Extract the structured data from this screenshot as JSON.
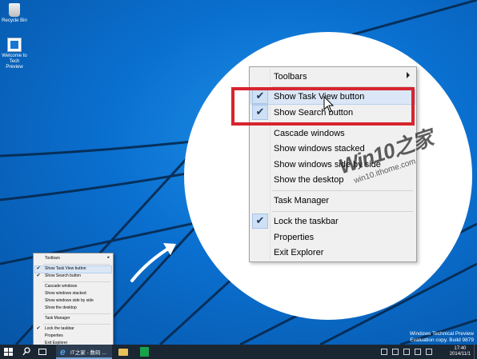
{
  "desktop": {
    "icons": [
      {
        "label": "Recycle Bin"
      },
      {
        "label": "Welcome to Tech Preview"
      }
    ],
    "evaluation": {
      "line1": "Windows Technical Preview",
      "line2": "Evaluation copy. Build 9879"
    }
  },
  "small_menu": {
    "items": [
      {
        "label": "Toolbars",
        "checked": false,
        "submenu": true
      },
      {
        "label": "Show Task View button",
        "checked": true
      },
      {
        "label": "Show Search button",
        "checked": true
      },
      {
        "label": "Cascade windows",
        "checked": false
      },
      {
        "label": "Show windows stacked",
        "checked": false
      },
      {
        "label": "Show windows side by side",
        "checked": false
      },
      {
        "label": "Show the desktop",
        "checked": false
      },
      {
        "label": "Task Manager",
        "checked": false
      },
      {
        "label": "Lock the taskbar",
        "checked": true
      },
      {
        "label": "Properties",
        "checked": false
      },
      {
        "label": "Exit Explorer",
        "checked": false
      }
    ]
  },
  "big_menu": {
    "items": [
      {
        "label": "Toolbars",
        "checked": false,
        "submenu": true
      },
      {
        "label": "Show Task View button",
        "checked": true
      },
      {
        "label": "Show Search button",
        "checked": true
      },
      {
        "label": "Cascade windows",
        "checked": false
      },
      {
        "label": "Show windows stacked",
        "checked": false
      },
      {
        "label": "Show windows side by side",
        "checked": false
      },
      {
        "label": "Show the desktop",
        "checked": false
      },
      {
        "label": "Task Manager",
        "checked": false
      },
      {
        "label": "Lock the taskbar",
        "checked": true
      },
      {
        "label": "Properties",
        "checked": false
      },
      {
        "label": "Exit Explorer",
        "checked": false
      }
    ]
  },
  "watermark": {
    "brand": "Win10之家",
    "url": "win10.ithome.com"
  },
  "taskbar": {
    "ie_label": "IT之家 - 数码 ...",
    "clock_time": "17:40",
    "clock_date": "2014/11/1"
  },
  "colors": {
    "highlight_box": "#d7252f",
    "desktop_blue": "#0a6fcf",
    "taskbar": "#1b2633"
  },
  "icons": [
    "windows-logo-icon",
    "search-icon",
    "task-view-icon",
    "internet-explorer-icon",
    "file-explorer-icon",
    "store-icon",
    "checkmark-icon",
    "submenu-arrow-icon",
    "mouse-cursor-icon",
    "curved-arrow-icon"
  ]
}
